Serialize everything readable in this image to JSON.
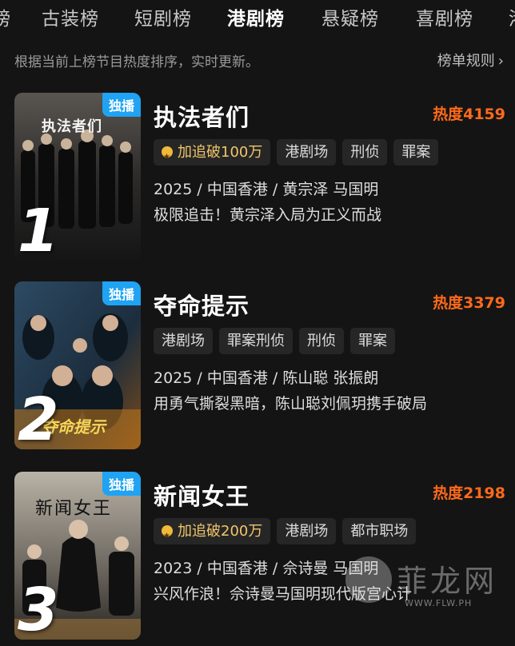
{
  "tabs": [
    {
      "label": "榜"
    },
    {
      "label": "古装榜"
    },
    {
      "label": "短剧榜"
    },
    {
      "label": "港剧榜",
      "active": true
    },
    {
      "label": "悬疑榜"
    },
    {
      "label": "喜剧榜"
    },
    {
      "label": "港"
    }
  ],
  "subbar": {
    "hint": "根据当前上榜节目热度排序，实时更新。",
    "rules": "榜单规则"
  },
  "items": [
    {
      "rank": "1",
      "badge": "独播",
      "title": "执法者们",
      "heat": "热度4159",
      "tags": [
        {
          "label": "加追破100万",
          "gold": true
        },
        {
          "label": "港剧场"
        },
        {
          "label": "刑侦"
        },
        {
          "label": "罪案"
        }
      ],
      "meta": "2025 / 中国香港 / 黄宗泽 马国明",
      "desc": "极限追击！黄宗泽入局为正义而战",
      "poster_text": "执法者们"
    },
    {
      "rank": "2",
      "badge": "独播",
      "title": "夺命提示",
      "heat": "热度3379",
      "tags": [
        {
          "label": "港剧场"
        },
        {
          "label": "罪案刑侦"
        },
        {
          "label": "刑侦"
        },
        {
          "label": "罪案"
        }
      ],
      "meta": "2025 / 中国香港 / 陈山聪 张振朗",
      "desc": "用勇气撕裂黑暗，陈山聪刘佩玥携手破局",
      "poster_text": "夺命提示"
    },
    {
      "rank": "3",
      "badge": "独播",
      "title": "新闻女王",
      "heat": "热度2198",
      "tags": [
        {
          "label": "加追破200万",
          "gold": true
        },
        {
          "label": "港剧场"
        },
        {
          "label": "都市职场"
        }
      ],
      "meta": "2023 / 中国香港 / 佘诗曼 马国明",
      "desc": "兴风作浪！佘诗曼马国明现代版宫心计",
      "poster_text": "新闻女王"
    }
  ],
  "watermark": {
    "cn": "菲龙网",
    "url": "WWW.FLW.PH"
  },
  "colors": {
    "background": "#141414",
    "heat": "#ff6a1a",
    "badge": "#1fa3f2",
    "gold_tag": "#f1c66a"
  }
}
